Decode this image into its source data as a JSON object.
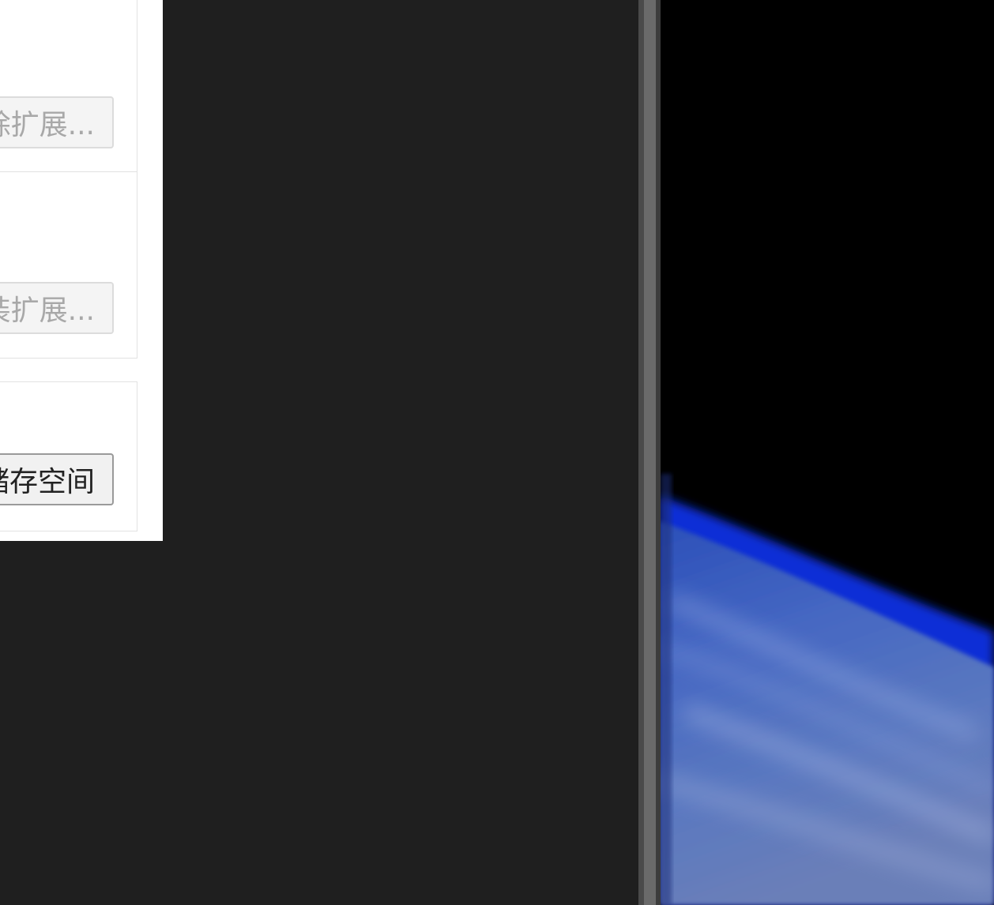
{
  "dialog": {
    "sections": [
      {
        "button_label": "除扩展...",
        "enabled": false
      },
      {
        "button_label": "装扩展...",
        "enabled": false
      },
      {
        "button_label": "储存空间",
        "enabled": true
      }
    ]
  },
  "wallpaper": {
    "icon": "earth-horizon-image",
    "colors": {
      "space": "#000000",
      "atmosphere": "#1633c8",
      "earth": "#4d6fc4"
    }
  }
}
